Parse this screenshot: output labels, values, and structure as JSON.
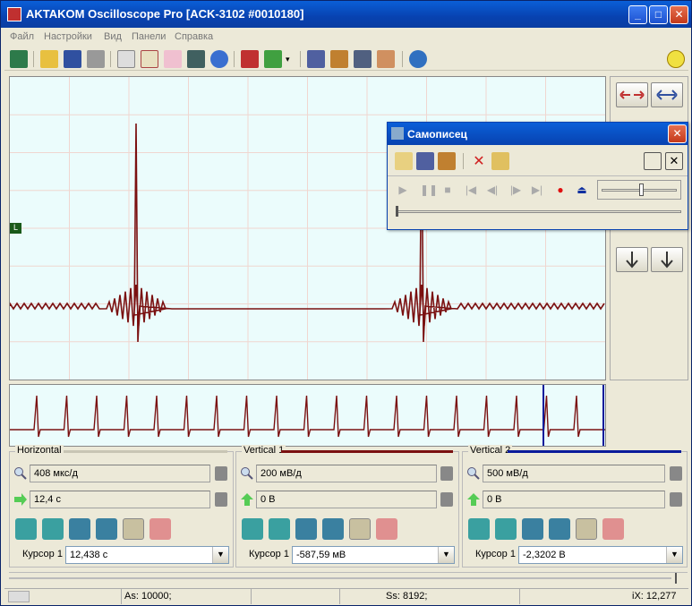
{
  "window": {
    "title": "AKTAKOM Oscilloscope Pro [ACK-3102 #0010180]"
  },
  "menu": [
    "Файл",
    "Настройки",
    "Вид",
    "Панели",
    "Справка"
  ],
  "colors": {
    "ch1": "#7a1010",
    "ch2": "#0a1a9a",
    "grid": "#f0d6d0",
    "bg": "#ebfcfc"
  },
  "toolbar": {
    "icons": [
      "exit-icon",
      "open-icon",
      "save-icon",
      "print-icon",
      "copy-icon",
      "notes-icon",
      "spectrum-icon",
      "screen-icon",
      "pause-icon",
      "trigger-icon",
      "export-icon",
      "info-panel-icon",
      "cursor-icon",
      "measure-icon",
      "palette-icon",
      "about-icon"
    ]
  },
  "scope": {
    "trigger_marker": "L"
  },
  "horizontal": {
    "title": "Horizontal",
    "scale": "408 мкс/д",
    "offset": "12,4 с",
    "cursor_label": "Курсор 1",
    "cursor_value": "12,438 с"
  },
  "vertical1": {
    "title": "Vertical 1",
    "scale": "200 мВ/д",
    "offset": "0 В",
    "cursor_label": "Курсор 1",
    "cursor_value": "-587,59 мВ"
  },
  "vertical2": {
    "title": "Vertical 2",
    "scale": "500 мВ/д",
    "offset": "0 В",
    "cursor_label": "Курсор 1",
    "cursor_value": "-2,3202 В"
  },
  "status": {
    "as": "As: 10000;",
    "ss": "Ss: 8192;",
    "ix": "iX: 12,277"
  },
  "recorder": {
    "title": "Самописец"
  }
}
